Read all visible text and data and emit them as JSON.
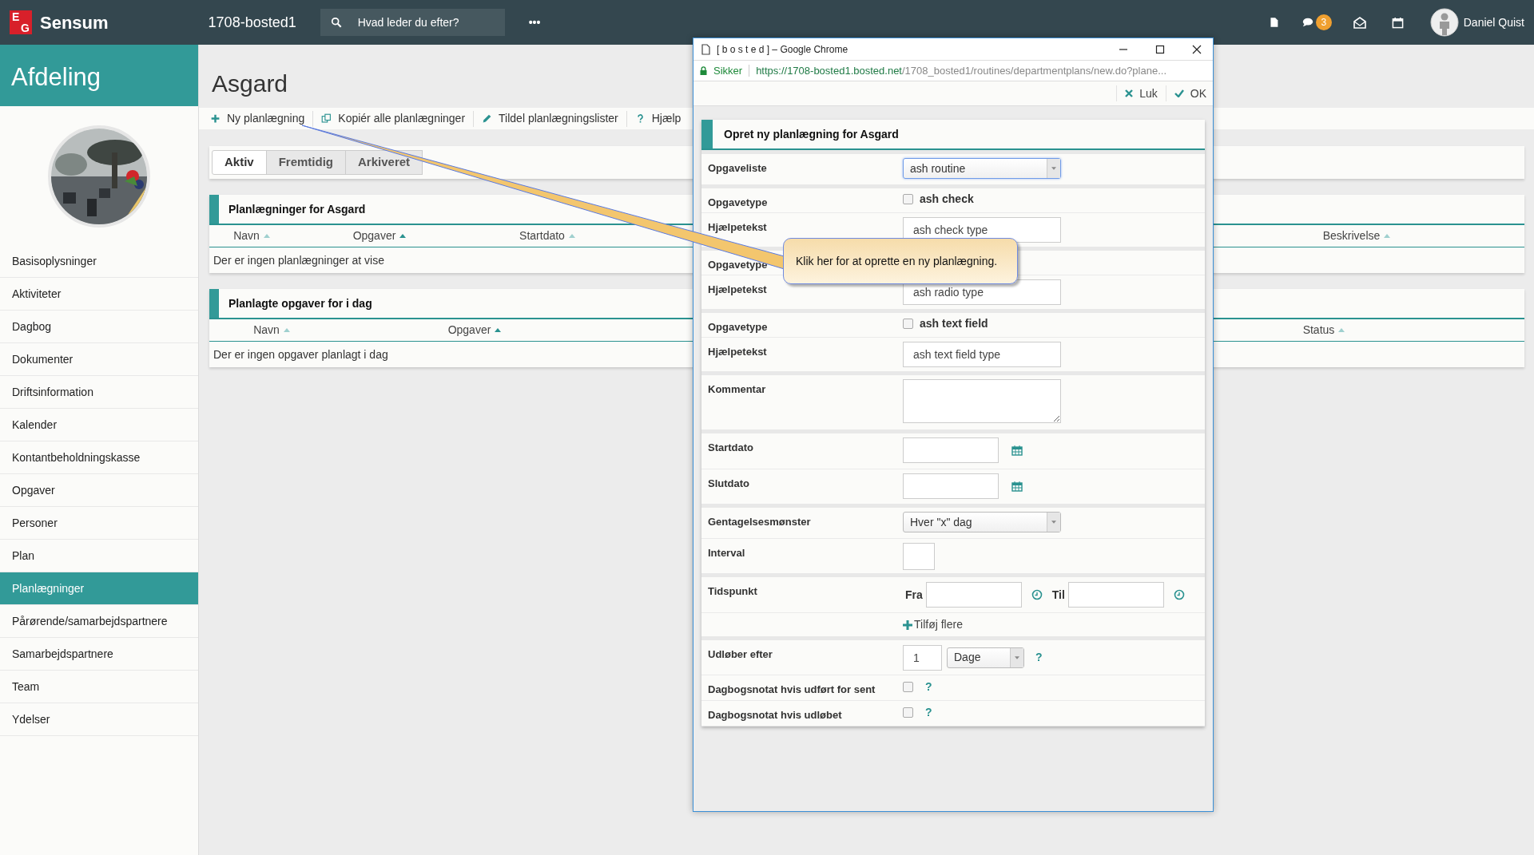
{
  "topbar": {
    "brand_mark": [
      "E",
      "G"
    ],
    "brand": "Sensum",
    "site": "1708-bosted1",
    "search": {
      "placeholder": "Hvad leder du efter?"
    },
    "more": "•••",
    "chat_badge": "3",
    "user": "Daniel Quist"
  },
  "sidebar": {
    "title": "Afdeling",
    "items": [
      {
        "label": "Basisoplysninger",
        "selected": false
      },
      {
        "label": "Aktiviteter",
        "selected": false
      },
      {
        "label": "Dagbog",
        "selected": false
      },
      {
        "label": "Dokumenter",
        "selected": false
      },
      {
        "label": "Driftsinformation",
        "selected": false
      },
      {
        "label": "Kalender",
        "selected": false
      },
      {
        "label": "Kontantbeholdningskasse",
        "selected": false
      },
      {
        "label": "Opgaver",
        "selected": false
      },
      {
        "label": "Personer",
        "selected": false
      },
      {
        "label": "Plan",
        "selected": false
      },
      {
        "label": "Planlægninger",
        "selected": true
      },
      {
        "label": "Pårørende/samarbejdspartnere",
        "selected": false
      },
      {
        "label": "Samarbejdspartnere",
        "selected": false
      },
      {
        "label": "Team",
        "selected": false
      },
      {
        "label": "Ydelser",
        "selected": false
      }
    ]
  },
  "page": {
    "title": "Asgard",
    "toolbar": [
      {
        "kind": "plus",
        "label": "Ny planlægning"
      },
      {
        "kind": "copy",
        "label": "Kopiér alle planlægninger"
      },
      {
        "kind": "pencil",
        "label": "Tildel planlægningslister"
      },
      {
        "kind": "help",
        "label": "Hjælp"
      }
    ],
    "tabs": [
      {
        "label": "Aktiv",
        "selected": true
      },
      {
        "label": "Fremtidig",
        "selected": false
      },
      {
        "label": "Arkiveret",
        "selected": false
      }
    ],
    "panels": [
      {
        "title": "Planlægninger for Asgard",
        "columns": [
          {
            "label": "Navn",
            "sorted": false
          },
          {
            "label": "Opgaver",
            "sorted": true
          },
          {
            "label": "Startdato",
            "sorted": false
          },
          {
            "label": "Beskrivelse",
            "sorted": false
          }
        ],
        "empty_text": "Der er ingen planlægninger at vise"
      },
      {
        "title": "Planlagte opgaver for i dag",
        "columns": [
          {
            "label": "Navn",
            "sorted": false
          },
          {
            "label": "Opgaver",
            "sorted": true
          },
          {
            "label": "Status",
            "sorted": false
          }
        ],
        "empty_text": "Der er ingen opgaver planlagt i dag"
      }
    ]
  },
  "popup": {
    "title": "[ b o s t e d ] – Google Chrome",
    "security": "Sikker",
    "url_host": "https://1708-bosted1.bosted.net",
    "url_path": "/1708_bosted1/routines/departmentplans/new.do?plane...",
    "actions": [
      {
        "kind": "close",
        "label": "Luk"
      },
      {
        "kind": "ok",
        "label": "OK"
      }
    ],
    "form_title": "Opret ny planlægning for Asgard",
    "groups": [
      [
        {
          "kind": "select",
          "label": "Opgaveliste",
          "value": "ash routine",
          "focused": true
        }
      ],
      [
        {
          "kind": "checkbox",
          "label": "Opgavetype",
          "text": "ash check",
          "checked": false
        },
        {
          "kind": "text",
          "label": "Hjælpetekst",
          "value": "ash check type"
        }
      ],
      [
        {
          "kind": "label",
          "label": "Opgavetype"
        },
        {
          "kind": "text",
          "label": "Hjælpetekst",
          "value": "ash radio type"
        }
      ],
      [
        {
          "kind": "checkbox",
          "label": "Opgavetype",
          "text": "ash text field",
          "checked": false
        },
        {
          "kind": "text",
          "label": "Hjælpetekst",
          "value": "ash text field type"
        }
      ],
      [
        {
          "kind": "textarea",
          "label": "Kommentar"
        }
      ],
      [
        {
          "kind": "date",
          "label": "Startdato"
        },
        {
          "kind": "date",
          "label": "Slutdato"
        }
      ],
      [
        {
          "kind": "select",
          "label": "Gentagelsesmønster",
          "value": "Hver \"x\" dag",
          "focused": false
        },
        {
          "kind": "number",
          "label": "Interval"
        }
      ],
      [
        {
          "kind": "time",
          "label": "Tidspunkt",
          "from_label": "Fra",
          "to_label": "Til"
        },
        {
          "kind": "add",
          "text": "Tilføj flere"
        }
      ],
      [
        {
          "kind": "expiry",
          "label": "Udløber efter",
          "value": "1",
          "unit": "Dage",
          "help": "?"
        },
        {
          "kind": "flag",
          "label": "Dagbogsnotat hvis udført for sent",
          "checked": false,
          "help": "?"
        },
        {
          "kind": "flag",
          "label": "Dagbogsnotat hvis udløbet",
          "checked": false,
          "help": "?"
        }
      ]
    ]
  },
  "callout": {
    "text": "Klik her for at oprette en ny planlægning."
  }
}
